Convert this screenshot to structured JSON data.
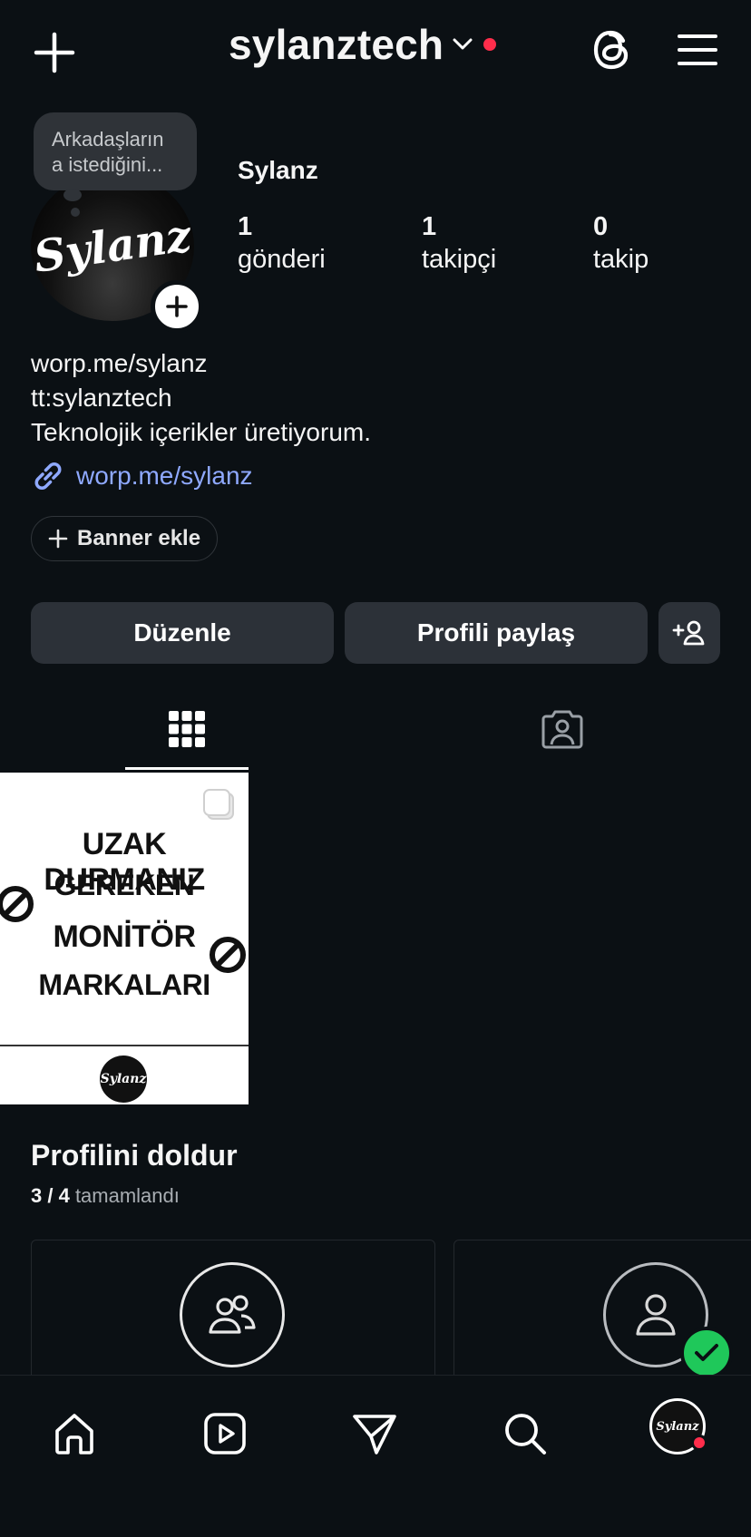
{
  "header": {
    "username": "sylanztech"
  },
  "profile": {
    "note": "Arkadaşların\na istediğini...",
    "avatar_text": "Sylanz",
    "display_name": "Sylanz",
    "stats": [
      {
        "value": "1",
        "label": "gönderi"
      },
      {
        "value": "1",
        "label": "takipçi"
      },
      {
        "value": "0",
        "label": "takip"
      }
    ],
    "bio_lines": [
      "worp.me/sylanz",
      "tt:sylanztech",
      "Teknolojik içerikler üretiyorum."
    ],
    "link": "worp.me/sylanz",
    "banner_label": "Banner ekle"
  },
  "actions": {
    "edit": "Düzenle",
    "share": "Profili paylaş"
  },
  "post": {
    "lines": [
      "UZAK DURMANIZ",
      "GEREKEN",
      "MONİTÖR",
      "MARKALARI"
    ],
    "logo_text": "Sylanz"
  },
  "complete_profile": {
    "title": "Profilini doldur",
    "progress": "3 / 4",
    "progress_suffix": "tamamlandı"
  },
  "nav": {
    "avatar_text": "Sylanz"
  },
  "colors": {
    "background": "#0b1014",
    "button": "#2c3138",
    "link": "#8fa9ff",
    "notification": "#ff2d4b",
    "success": "#1fc85a"
  }
}
